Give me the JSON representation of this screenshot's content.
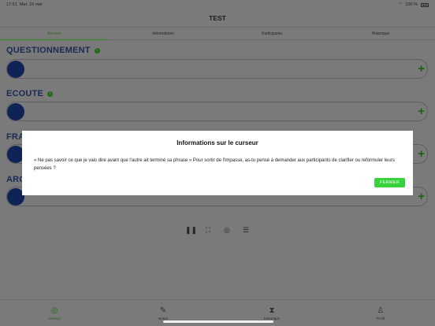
{
  "status_bar": {
    "time": "17:51",
    "date": "Mar. 16 mai",
    "battery": "100 %"
  },
  "title": "TEST",
  "tabs": [
    "Session",
    "Informations",
    "Participants",
    "Historique"
  ],
  "sections": [
    {
      "title": "QUESTIONNEMENT",
      "info": "i"
    },
    {
      "title": "ECOUTE",
      "info": "i"
    },
    {
      "title": "FRA"
    },
    {
      "title": "ARG"
    }
  ],
  "plus_symbol": "+",
  "controls": [
    "pause-icon",
    "fullscreen-icon",
    "record-icon",
    "list-icon"
  ],
  "bottom_nav": [
    {
      "label": "Session",
      "icon": "session-icon"
    },
    {
      "label": "Notes",
      "icon": "pencil-icon"
    },
    {
      "label": "Historique",
      "icon": "hourglass-icon"
    },
    {
      "label": "Profil",
      "icon": "profile-icon"
    }
  ],
  "modal": {
    "title": "Informations sur le curseur",
    "body": "« Ne pas savoir ce que je vais dire avant que l'autre ait terminé sa phrase » Pour sortir de l'impasse, as-tu pensé à demander aux participants de clarifier ou reformuler leurs pensées ?",
    "button": "FERMER"
  },
  "colors": {
    "accent_green": "#35d43a",
    "navy": "#0f2357",
    "overlay": "#7a7a7a"
  }
}
